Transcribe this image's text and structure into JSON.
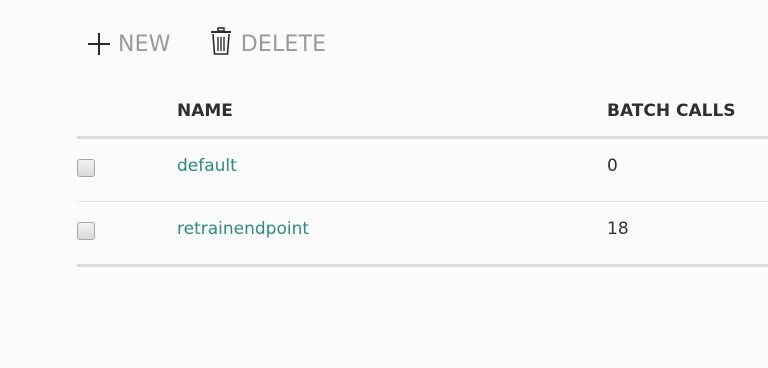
{
  "toolbar": {
    "new_label": "NEW",
    "delete_label": "DELETE",
    "new_icon": "plus-icon",
    "delete_icon": "trash-icon"
  },
  "table": {
    "columns": [
      "NAME",
      "BATCH CALLS"
    ],
    "rows": [
      {
        "name": "default",
        "batch_calls": "0"
      },
      {
        "name": "retrainendpoint",
        "batch_calls": "18"
      }
    ]
  },
  "colors": {
    "link": "#2e8b7e",
    "toolbar_text": "#9a9a9a",
    "header_text": "#2f2f2f"
  }
}
